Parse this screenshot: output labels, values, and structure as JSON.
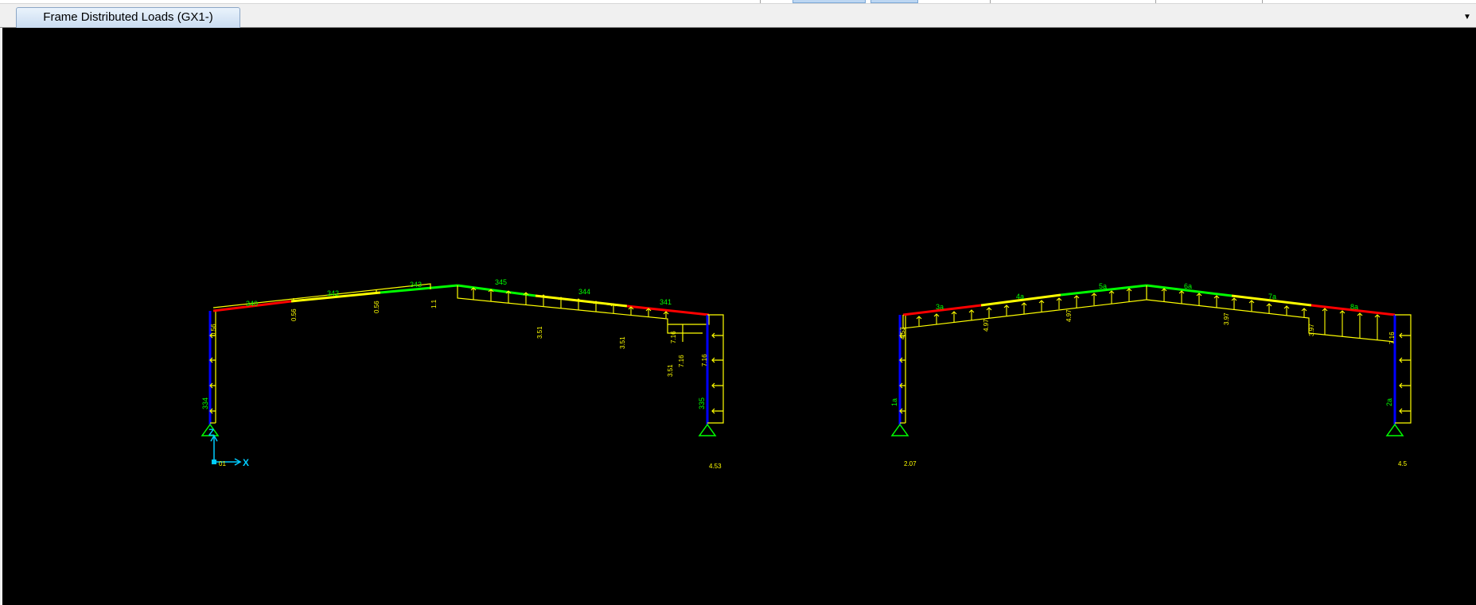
{
  "window": {
    "tab_label": "Frame Distributed Loads (GX1-)",
    "dropdown_icon": "chevron-down-icon"
  },
  "colors": {
    "background": "#000000",
    "column": "#0000ff",
    "load_diagram": "#ffff00",
    "label": "#00ff00",
    "support": "#00ff00",
    "axis": "#00ccff",
    "member_high": "#ff0000",
    "member_mid": "#ffff00",
    "member_low": "#00ff00"
  },
  "axes": {
    "z_label": "Z",
    "x_label": "X",
    "origin_label": "01"
  },
  "frame_left": {
    "members": [
      {
        "id": "340",
        "label": "340"
      },
      {
        "id": "342",
        "label": "342"
      },
      {
        "id": "343",
        "label": "343"
      },
      {
        "id": "345",
        "label": "345"
      },
      {
        "id": "344",
        "label": "344"
      },
      {
        "id": "341",
        "label": "341"
      },
      {
        "id": "334",
        "label": "334"
      },
      {
        "id": "335",
        "label": "335"
      }
    ],
    "load_values": [
      "0.56",
      "0.56",
      "0.56",
      "1.1",
      "3.51",
      "3.51",
      "7.16",
      "3.51",
      "7.16",
      "7.16"
    ],
    "base_left_label": "",
    "base_right_label": "4.53"
  },
  "frame_right": {
    "members": [
      {
        "id": "3a",
        "label": "3a"
      },
      {
        "id": "4a",
        "label": "4a"
      },
      {
        "id": "5a",
        "label": "5a"
      },
      {
        "id": "6a",
        "label": "6a"
      },
      {
        "id": "7a",
        "label": "7a"
      },
      {
        "id": "8a",
        "label": "8a"
      },
      {
        "id": "1a",
        "label": "1a"
      },
      {
        "id": "2a",
        "label": "2a"
      }
    ],
    "load_values": [
      "4.53",
      "4.97",
      "4.97",
      "3.97",
      "3.97",
      "7.16"
    ],
    "base_left_label": "2.07",
    "base_right_label": "4.5"
  }
}
